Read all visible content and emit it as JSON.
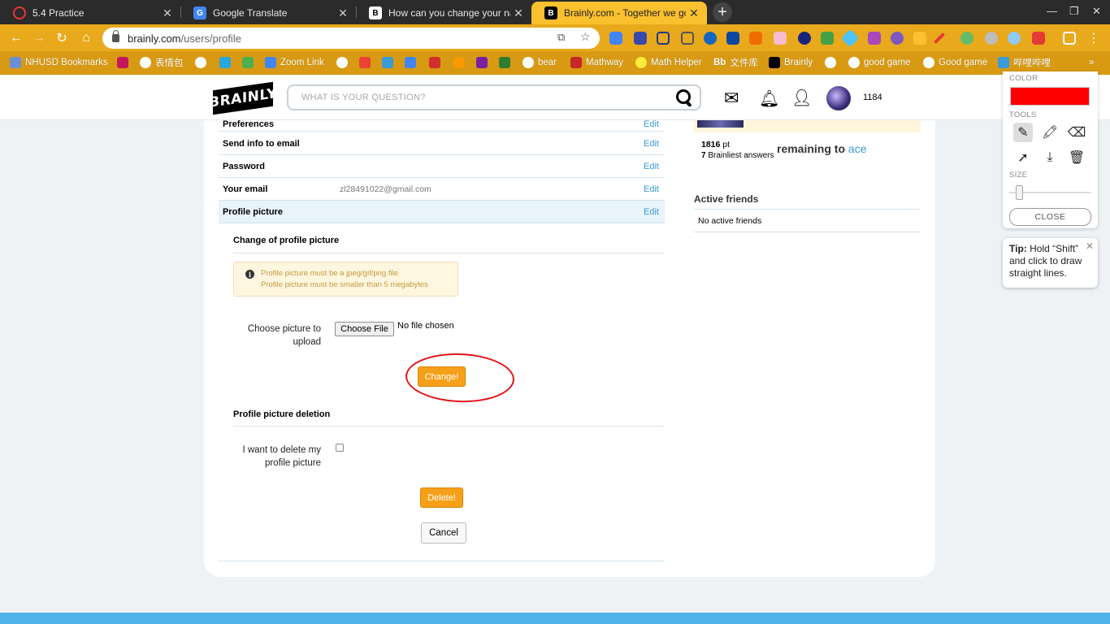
{
  "browser": {
    "tabs": [
      {
        "title": "5.4 Practice",
        "favicon": "target-icon",
        "active": false
      },
      {
        "title": "Google Translate",
        "favicon": "translate-icon",
        "active": false
      },
      {
        "title": "How can you change your name",
        "favicon": "brainly-icon",
        "active": false
      },
      {
        "title": "Brainly.com - Together we go far",
        "favicon": "brainly-icon",
        "active": true
      }
    ],
    "url": {
      "host": "brainly.com",
      "path": "/users/profile"
    },
    "bookmarks": [
      {
        "label": "NHUSD Bookmarks",
        "color": "#6b8fd6"
      },
      {
        "label": "",
        "color": "#c2185b"
      },
      {
        "label": "表情包",
        "color": "#ffffff"
      },
      {
        "label": "",
        "color": "#ffffff"
      },
      {
        "label": "",
        "color": "#2aa7e0"
      },
      {
        "label": "",
        "color": "#4caf50"
      },
      {
        "label": "Zoom Link",
        "color": "#4285f4"
      },
      {
        "label": "",
        "color": "#ffffff"
      },
      {
        "label": "",
        "color": "#ea4335"
      },
      {
        "label": "",
        "color": "#3a9bd6"
      },
      {
        "label": "",
        "color": "#4285f4"
      },
      {
        "label": "",
        "color": "#d32f2f"
      },
      {
        "label": "",
        "color": "#ff9800"
      },
      {
        "label": "",
        "color": "#7b1fa2"
      },
      {
        "label": "",
        "color": "#2e7d32"
      },
      {
        "label": "bear",
        "color": "#ffffff"
      },
      {
        "label": "Mathway",
        "color": "#c62828"
      },
      {
        "label": "Math Helper",
        "color": "#ffeb3b"
      },
      {
        "label": "文件库",
        "color": "#222222"
      },
      {
        "label": "Brainly",
        "color": "#000000"
      },
      {
        "label": "",
        "color": "#ffffff"
      },
      {
        "label": "good game",
        "color": "#ffffff"
      },
      {
        "label": "Good game",
        "color": "#ffffff"
      },
      {
        "label": "哔哩哔哩",
        "color": "#3a9bd6"
      }
    ],
    "bookmarks_more": "»"
  },
  "header": {
    "logo": "BRAINLY",
    "search_placeholder": "WHAT IS YOUR QUESTION?",
    "points": "1184"
  },
  "settings_rows": [
    {
      "label": "Preferences",
      "value": "",
      "edit": "Edit"
    },
    {
      "label": "Send info to email",
      "value": "",
      "edit": "Edit"
    },
    {
      "label": "Password",
      "value": "",
      "edit": "Edit"
    },
    {
      "label": "Your email",
      "value": "zl28491022@gmail.com",
      "edit": "Edit"
    },
    {
      "label": "Profile picture",
      "value": "",
      "edit": "Edit"
    }
  ],
  "change_picture": {
    "title": "Change of profile picture",
    "info_line1": "Profile picture must be a jpeg/gif/png file",
    "info_line2": "Profile picture must be smaller than 5 megabytes",
    "choose_label_line1": "Choose picture to",
    "choose_label_line2": "upload",
    "file_button": "Choose File",
    "file_status": "No file chosen",
    "submit": "Change!"
  },
  "delete_picture": {
    "title": "Profile picture deletion",
    "label_line1": "I want to delete my",
    "label_line2": "profile picture",
    "submit": "Delete!",
    "cancel": "Cancel"
  },
  "sidebar": {
    "points_value": "1816",
    "points_unit": "pt",
    "brainliest_count": "7",
    "brainliest_label": "Brainliest answers",
    "remaining_text": "remaining to",
    "rank": "ace",
    "active_friends_title": "Active friends",
    "no_active": "No active friends"
  },
  "draw_tool": {
    "color_label": "COLOR",
    "color_value": "#ff0000",
    "tools_label": "TOOLS",
    "size_label": "SIZE",
    "close": "CLOSE",
    "tip_bold": "Tip:",
    "tip_text": "Hold “Shift” and click to draw straight lines."
  }
}
